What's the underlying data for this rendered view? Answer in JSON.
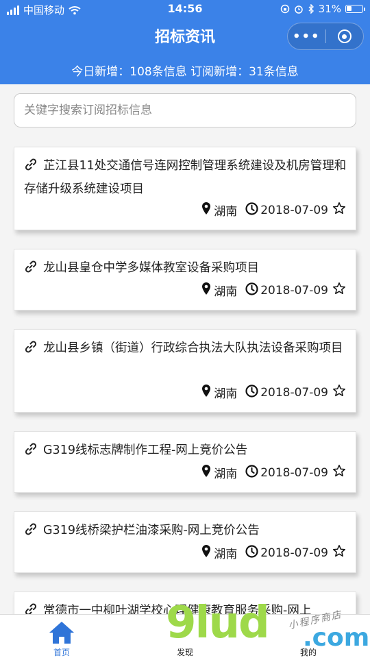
{
  "status_bar": {
    "carrier": "中国移动",
    "time": "14:56",
    "battery": "31%",
    "battery_level": 0.31
  },
  "nav": {
    "title": "招标资讯",
    "more_glyph": "•••"
  },
  "stats": {
    "text": "今日新增：108条信息 订阅新增：31条信息"
  },
  "search": {
    "placeholder": "关键字搜索订阅招标信息"
  },
  "items": [
    {
      "title": "芷江县11处交通信号连网控制管理系统建设及机房管理和存储升级系统建设项目",
      "region": "湖南",
      "date": "2018-07-09"
    },
    {
      "title": "龙山县皇仓中学多媒体教室设备采购项目",
      "region": "湖南",
      "date": "2018-07-09"
    },
    {
      "title": "龙山县乡镇（街道）行政综合执法大队执法设备采购项目",
      "region": "湖南",
      "date": "2018-07-09"
    },
    {
      "title": "G319线标志牌制作工程-网上竞价公告",
      "region": "湖南",
      "date": "2018-07-09"
    },
    {
      "title": "G319线桥梁护栏油漆采购-网上竞价公告",
      "region": "湖南",
      "date": "2018-07-09"
    },
    {
      "title": "常德市一中柳叶湖学校心理健康教育服务采购-网上",
      "region": "",
      "date": ""
    }
  ],
  "tabbar": {
    "home": "首页",
    "discover": "发现",
    "mine": "我的"
  },
  "watermark": {
    "main": "9lud",
    "domain": ".com",
    "tagline": "小程序商店"
  },
  "colors": {
    "primary": "#3b82e8",
    "tab_active": "#2f74d8"
  },
  "icons": {
    "item_link": "link-icon",
    "region": "map-pin-icon",
    "date": "clock-icon",
    "favorite": "star-outline-icon",
    "home": "home-icon"
  }
}
